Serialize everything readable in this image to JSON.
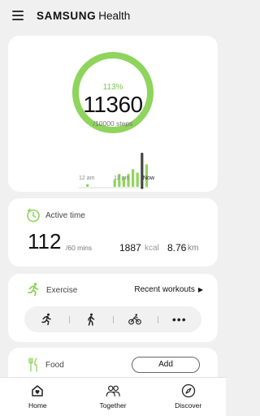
{
  "app": {
    "brand_bold": "SAMSUNG",
    "brand_light": "Health"
  },
  "steps": {
    "percent_label": "113%",
    "count": "11360",
    "goal_label": "/10000 steps",
    "progress_fraction": 1.0,
    "accent": "#8fd45c",
    "chart": {
      "x_labels": [
        "12 am",
        "12 pm",
        "Now"
      ],
      "bar_values": [
        0.08,
        0,
        0,
        0,
        0,
        0,
        0.22,
        0.38,
        0.3,
        0.38,
        0.52,
        0.42,
        1.0,
        0.66
      ]
    }
  },
  "active": {
    "title": "Active time",
    "minutes": "112",
    "minutes_unit": "/60 mins",
    "kcal": "1887",
    "kcal_unit": "kcal",
    "distance": "8.76",
    "distance_unit": "km"
  },
  "exercise": {
    "title": "Exercise",
    "recent_label": "Recent workouts",
    "types": [
      "running-icon",
      "walking-icon",
      "cycling-icon",
      "more-icon"
    ],
    "more_label": "•••"
  },
  "food": {
    "title": "Food",
    "add_label": "Add"
  },
  "nav": {
    "home": "Home",
    "together": "Together",
    "discover": "Discover"
  }
}
